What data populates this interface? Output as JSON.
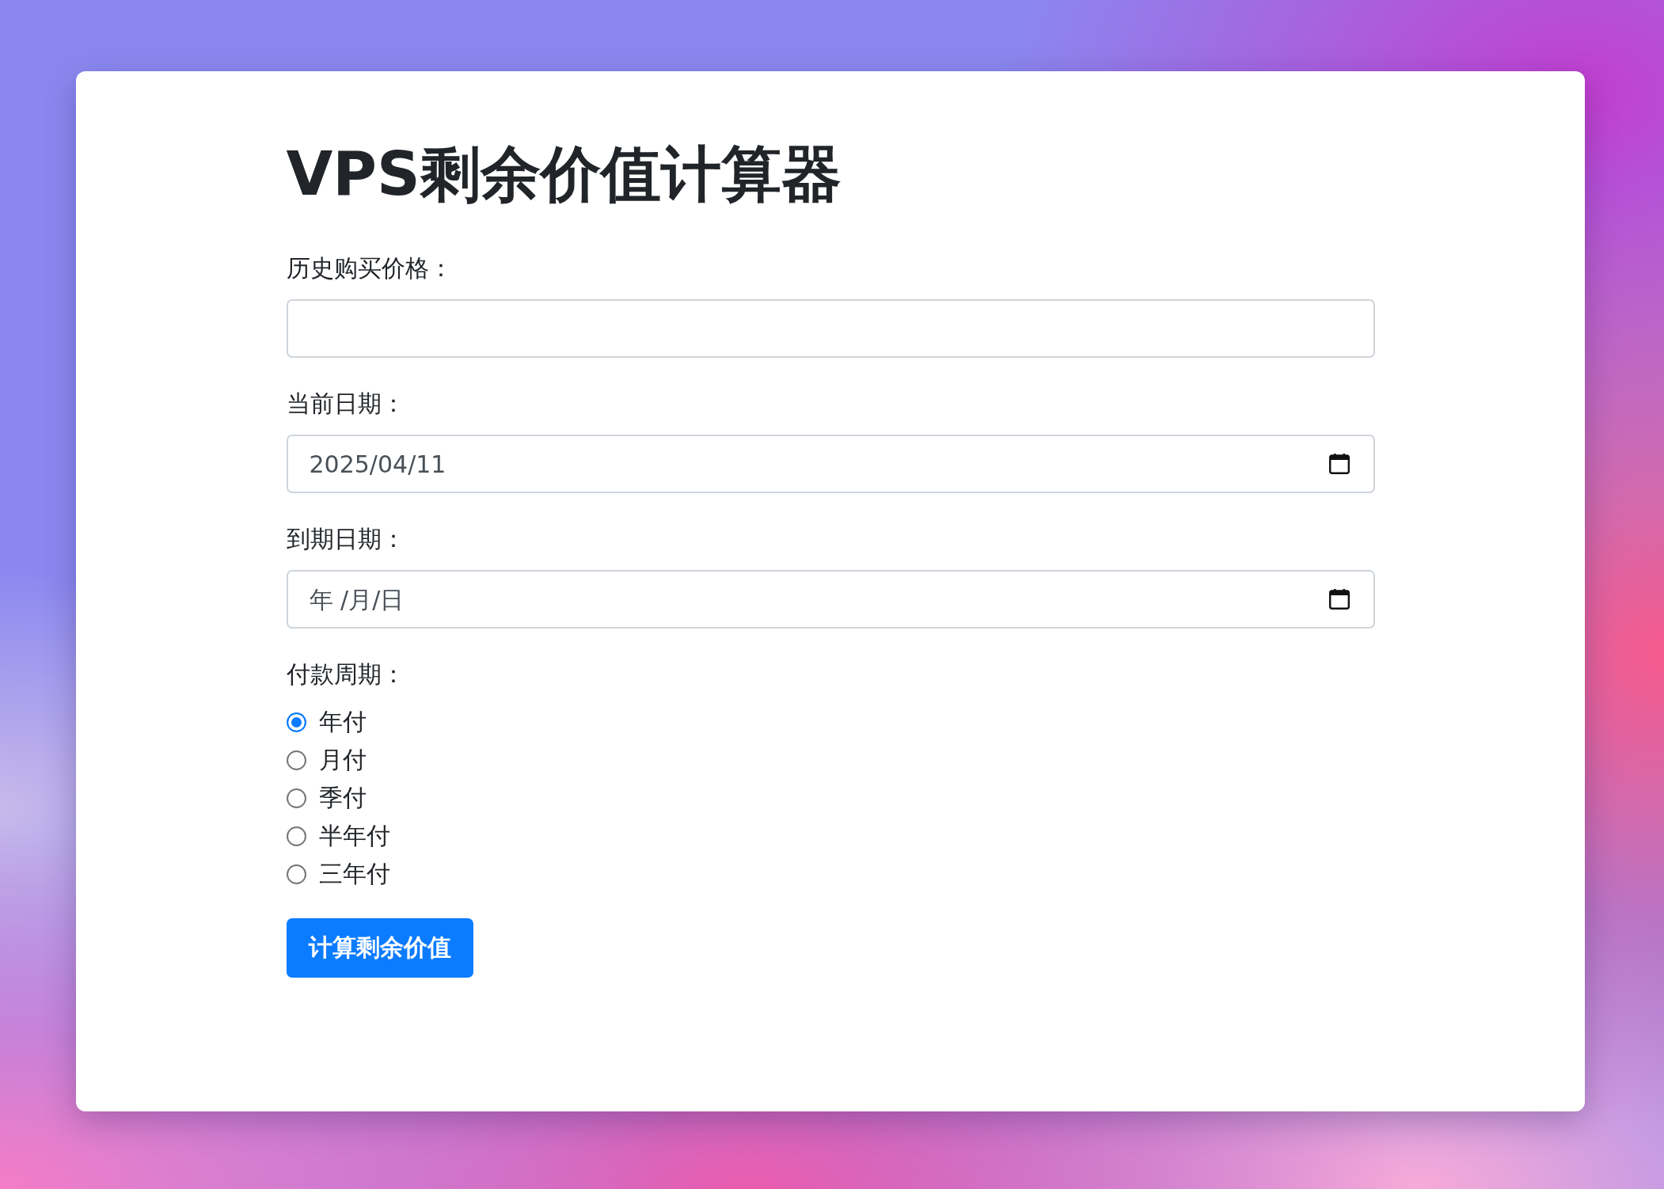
{
  "title": "VPS剩余价值计算器",
  "fields": [
    {
      "kind": "text",
      "label": "历史购买价格："
    },
    {
      "kind": "date",
      "label": "当前日期：",
      "value": "2025/04/11"
    },
    {
      "kind": "date",
      "label": "到期日期：",
      "placeholder": "年 /月/日"
    }
  ],
  "payment_cycle": {
    "label": "付款周期：",
    "options": [
      {
        "label": "年付",
        "selected": true
      },
      {
        "label": "月付",
        "selected": false
      },
      {
        "label": "季付",
        "selected": false
      },
      {
        "label": "半年付",
        "selected": false
      },
      {
        "label": "三年付",
        "selected": false
      }
    ]
  },
  "submit_button": "计算剩余价值"
}
